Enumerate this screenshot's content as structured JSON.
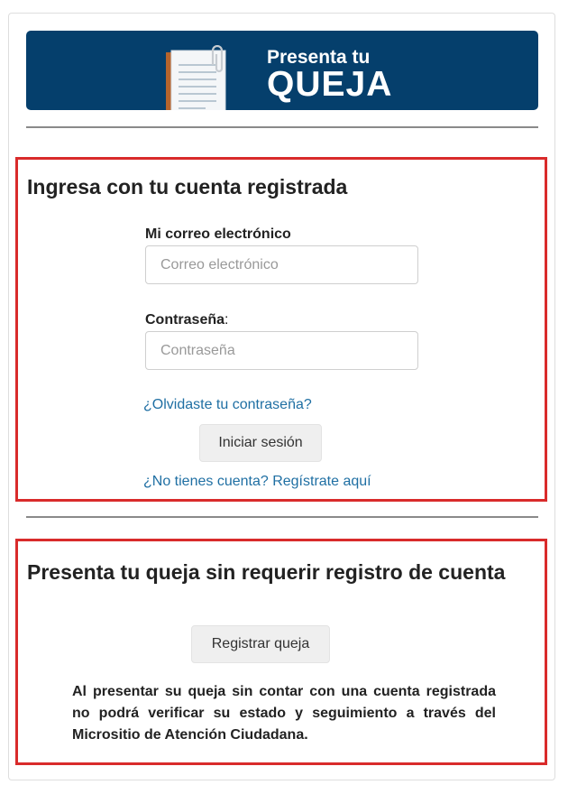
{
  "banner": {
    "line1": "Presenta tu",
    "line2": "QUEJA",
    "bg_color": "#053f6c",
    "icon": "document-clip-icon"
  },
  "login": {
    "title": "Ingresa con tu cuenta registrada",
    "email_label": "Mi correo electrónico",
    "email_placeholder": "Correo electrónico",
    "email_value": "",
    "password_label": "Contraseña",
    "password_colon": ":",
    "password_placeholder": "Contraseña",
    "password_value": "",
    "forgot_link": "¿Olvidaste tu contraseña?",
    "submit_label": "Iniciar sesión",
    "register_link": "¿No tienes cuenta? Regístrate aquí"
  },
  "anonymous": {
    "title": "Presenta tu queja sin requerir registro de cuenta",
    "button_label": "Registrar queja",
    "note": "Al presentar su queja sin contar con una cuenta registrada no podrá verificar su estado y seguimiento a través del Micrositio de Atención Ciudadana."
  },
  "colors": {
    "section_border": "#d92b2b",
    "link": "#1f6fa3",
    "divider": "#8a8a8a"
  }
}
